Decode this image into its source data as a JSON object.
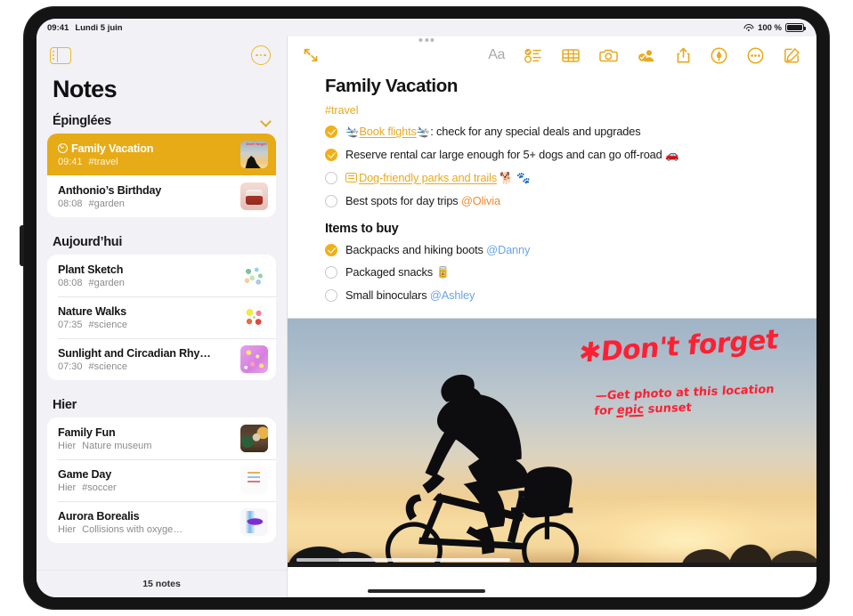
{
  "status_bar": {
    "time": "09:41",
    "date": "Lundi 5 juin",
    "wifi_icon": "wifi-icon",
    "battery_label": "100 %",
    "battery_icon": "battery-icon"
  },
  "sidebar": {
    "toggle_icon": "sidebar-toggle-icon",
    "more_icon": "more-ellipsis-icon",
    "title": "Notes",
    "footer_count": "15 notes",
    "sections": [
      {
        "label": "Épinglées",
        "chevron_icon": "chevron-down-icon",
        "notes": [
          {
            "title": "Family Vacation",
            "time": "09:41",
            "tag": "#travel",
            "locked": true,
            "thumb": "th-cyclist",
            "selected": true,
            "scribble": "Don't forget"
          },
          {
            "title": "Anthonio’s Birthday",
            "time": "08:08",
            "tag": "#garden",
            "locked": false,
            "thumb": "th-cake",
            "selected": false
          }
        ]
      },
      {
        "label": "Aujourd’hui",
        "chevron_icon": "",
        "notes": [
          {
            "title": "Plant Sketch",
            "time": "08:08",
            "tag": "#garden",
            "locked": false,
            "thumb": "th-plant",
            "selected": false
          },
          {
            "title": "Nature Walks",
            "time": "07:35",
            "tag": "#science",
            "locked": false,
            "thumb": "th-nature",
            "selected": false
          },
          {
            "title": "Sunlight and Circadian Rhy…",
            "time": "07:30",
            "tag": "#science",
            "locked": false,
            "thumb": "th-sun",
            "selected": false
          }
        ]
      },
      {
        "label": "Hier",
        "chevron_icon": "",
        "notes": [
          {
            "title": "Family Fun",
            "time": "Hier",
            "tag": "Nature museum",
            "locked": false,
            "thumb": "th-familyfun",
            "selected": false
          },
          {
            "title": "Game Day",
            "time": "Hier",
            "tag": "#soccer",
            "locked": false,
            "thumb": "th-game",
            "selected": false
          },
          {
            "title": "Aurora Borealis",
            "time": "Hier",
            "tag": "Collisions with oxyge…",
            "locked": false,
            "thumb": "th-aurora",
            "selected": false
          }
        ]
      }
    ]
  },
  "detail": {
    "toolbar": {
      "expand_icon": "expand-arrows-icon",
      "format_label": "Aa",
      "checklist_icon": "checklist-icon",
      "table_icon": "table-icon",
      "camera_icon": "camera-icon",
      "collaborate_icon": "add-person-icon",
      "share_icon": "share-icon",
      "markup_icon": "markup-pen-icon",
      "more_icon": "more-ellipsis-icon",
      "compose_icon": "compose-icon"
    },
    "note": {
      "title": "Family Vacation",
      "tag": "#travel",
      "checklist": [
        {
          "done": true,
          "prefix_emoji": "🛬",
          "link_text": "Book flights",
          "suffix_emoji": "🛬",
          "text": ": check for any special deals and upgrades"
        },
        {
          "done": true,
          "text": "Reserve rental car large enough for 5+ dogs and can go off-road ",
          "trailing_emoji": "🚗"
        },
        {
          "done": false,
          "doc_icon": "note-link-icon",
          "link_text": "Dog-friendly parks and trails",
          "trailing_emoji": " 🐕 🐾"
        },
        {
          "done": false,
          "text": "Best spots for day trips ",
          "mention": "@Olivia",
          "mention_color": "orange"
        }
      ],
      "section_title": "Items to buy",
      "buy_list": [
        {
          "done": true,
          "text": "Backpacks and hiking boots ",
          "mention": "@Danny",
          "mention_color": "blue"
        },
        {
          "done": false,
          "text": "Packaged snacks ",
          "trailing_emoji": "🥫"
        },
        {
          "done": false,
          "text": "Small binoculars ",
          "mention": "@Ashley",
          "mention_color": "blue"
        }
      ],
      "photo": {
        "alt": "cyclist-silhouette-at-sunset",
        "annotation_heading": "✱Don't forget",
        "annotation_line1_pre": "—Get photo at this location",
        "annotation_line2_pre": "for ",
        "annotation_line2_underline": "epic",
        "annotation_line2_post": " sunset"
      }
    }
  },
  "colors": {
    "accent": "#e8a91f",
    "selected_row": "#e6ab16",
    "mention_blue": "#6aa4e8",
    "mention_orange": "#ef8a33",
    "scribble_red": "#fc2033"
  }
}
